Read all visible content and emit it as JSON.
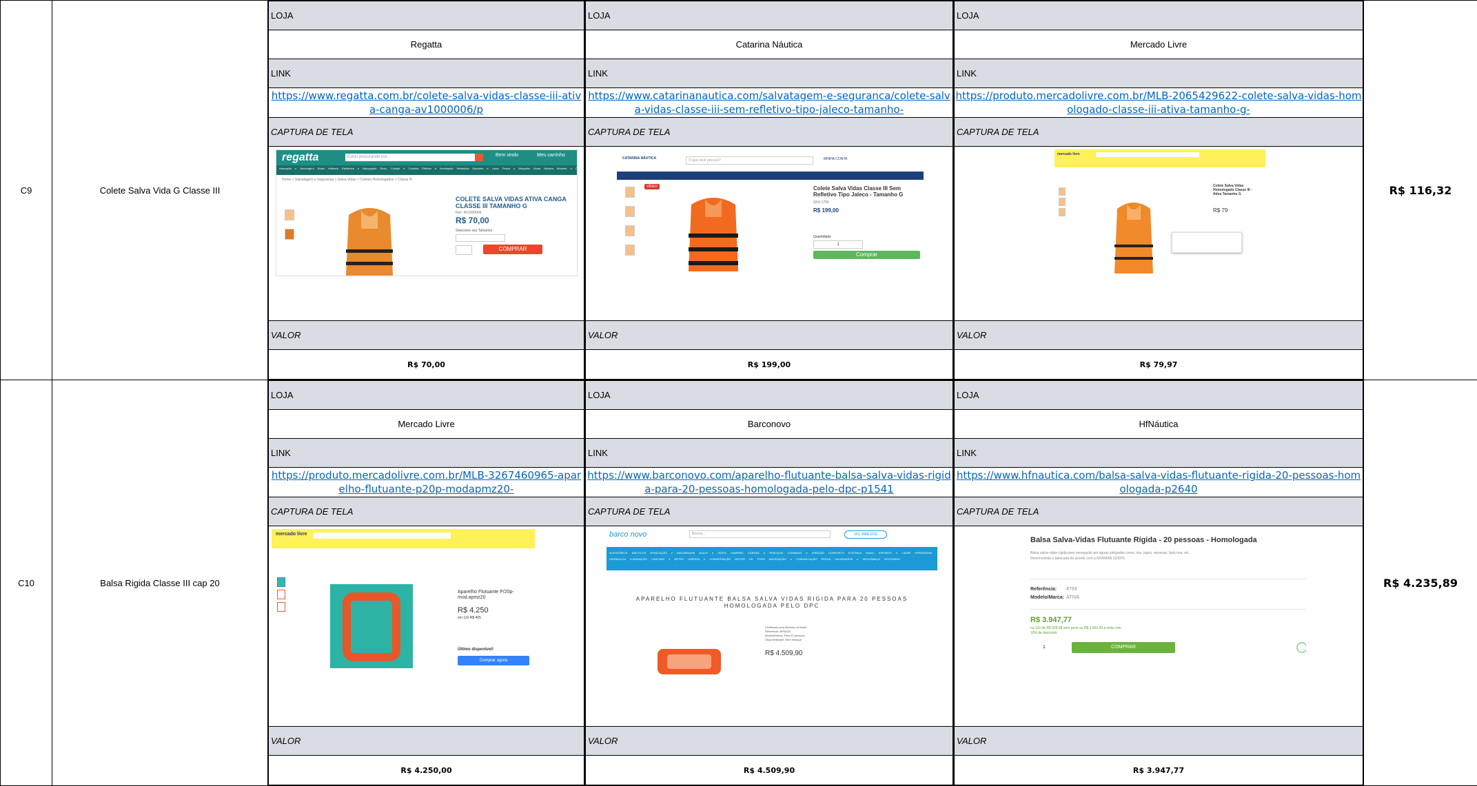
{
  "labels": {
    "loja": "LOJA",
    "link": "LINK",
    "captura": "CAPTURA DE TELA",
    "valor": "VALOR"
  },
  "rows": [
    {
      "code": "C9",
      "description": "Colete Salva Vida G Classe III",
      "average": "R$ 116,32",
      "stores": [
        {
          "name": "Regatta",
          "link": "https://www.regatta.com.br/colete-salva-vidas-classe-iii-ativa-canga-av1000006/p",
          "price": "R$ 70,00",
          "shot": {
            "logo": "regatta",
            "search": "Estou procurando por...",
            "login": "Bem vindo",
            "cart": "Meu carrinho",
            "nav": [
              "Atracação e Ancoragem",
              "Botes Infláveis",
              "Eletrônica e Navegação",
              "Deck, Cockpit e Cozinha",
              "Elétrica e Iluminação",
              "Hidráulica",
              "Esportes e Lazer",
              "Pesca e Mergulho",
              "Moda Náutica",
              "Motores e Óleos",
              "Vela e Barco",
              "Salvatagem e Segurança"
            ],
            "breadcrumb": "Home > Salvatagem e Segurança > Salva-Vidas > Coletes Homologados > Classe III",
            "title": "COLETE SALVA VIDAS ATIVA CANGA CLASSE III TAMANHO G",
            "ref": "Ref.: AV1000006",
            "price": "R$ 70,00",
            "size_label": "Selecione seu Tamanho",
            "sizes": [
              "P",
              "M",
              "G",
              "GG"
            ],
            "button": "COMPRAR",
            "accent": "#1f8f86"
          }
        },
        {
          "name": "Catarina Náutica",
          "link": "https://www.catarinanautica.com/salvatagem-e-seguranca/colete-salva-vidas-classe-iii-sem-refletivo-tipo-jaleco-tamanho-",
          "price": "R$ 199,00",
          "shot": {
            "logo": "CATARINA NÁUTICA",
            "search": "O que você procura?",
            "login": "MINHA CONTA",
            "title": "Colete Salva Vidas Classe III Sem Refletivo Tipo Jaleco - Tamanho G",
            "sku": "SKU:1755",
            "price": "R$ 199,00",
            "qty_label": "Quantidade",
            "qty": "1",
            "button": "Comprar",
            "badge": "VÍDEO",
            "accent": "#1d3f7a"
          }
        },
        {
          "name": "Mercado Livre",
          "link": "https://produto.mercadolivre.com.br/MLB-2065429622-colete-salva-vidas-homologado-classe-iii-ativa-tamanho-g-",
          "price": "R$ 79,97",
          "shot": {
            "logo": "mercado livre",
            "title": "Colete Salva Vidas Homologado Classe III - Ativa Tamanho G",
            "price": "R$ 79",
            "accent": "#fff159"
          }
        }
      ]
    },
    {
      "code": "C10",
      "description": "Balsa Rigida Classe III cap 20",
      "average": "R$ 4.235,89",
      "stores": [
        {
          "name": "Mercado Livre",
          "link": "https://produto.mercadolivre.com.br/MLB-3267460965-aparelho-flutuante-p20p-modapmz20-",
          "price": "R$ 4.250,00",
          "shot": {
            "logo": "mercado livre",
            "title": "Aparelho Flutuante P/20p-mod.apmz20",
            "price": "R$ 4.250",
            "installments": "em 12x R$ 405",
            "stock": "Último disponível!",
            "button": "Comprar agora",
            "accent": "#fff159"
          }
        },
        {
          "name": "Barconovo",
          "link": "https://www.barconovo.com/aparelho-flutuante-balsa-salva-vidas-rigida-para-20-pessoas-homologada-pelo-dpc-p1541",
          "price": "R$ 4.509,90",
          "shot": {
            "logo": "barco novo",
            "search": "Buscar...",
            "phone": "(41) 3088-2011",
            "nav": [
              "ACESSÓRIOS NÁUTICOS",
              "ATRACAÇÃO e ANCORAGEM",
              "ÁUDIO e VÍDEO",
              "CAMPING",
              "CORDAS e REBOQUE",
              "COMANDO e DIREÇÃO",
              "CONFORTO",
              "ELÉTRICA NAVAL",
              "ESPORTE e LAZER",
              "FERRAGENS",
              "HIDRÁULICA",
              "ILUMINAÇÃO",
              "LANCHAS e BOTES",
              "LIMPEZA e CONSERVAÇÃO",
              "MOTOR DE POPA",
              "NAVEGAÇÃO e COMUNICAÇÃO",
              "PESCA",
              "SALVATAGEM e SEGURANÇA",
              "VESTUÁRIO"
            ],
            "title": "APARELHO FLUTUANTE BALSA SALVA VIDAS RIGIDA PARA 20 PESSOAS HOMOLOGADA PELO DPC",
            "cert": "Certificado pela Marinha do Brasil",
            "ref": "Referência: APMZ20",
            "model": "Modelo/Marca: Para 20 pessoas",
            "avail": "Disponibilidade: Sem estoque",
            "price": "R$ 4.509,90",
            "accent": "#1b9ad6"
          }
        },
        {
          "name": "HfNáutica",
          "link": "https://www.hfnautica.com/balsa-salva-vidas-flutuante-rigida-20-pessoas-homologada-p2640",
          "price": "R$ 3.947,77",
          "shot": {
            "title": "Balsa Salva-Vidas Flutuante Rígida - 20 pessoas - Homologada",
            "desc1": "Balsa salva-vidas rígida para navegação em águas abrigadas como: rios, lagos, represas, baía mar, etc.",
            "desc2": "Desenvolvida e fabricada de acordo com a NORMAN 02/DPC.",
            "ref_label": "Referência:",
            "ref": "4793",
            "brand_label": "Modelo/Marca:",
            "brand": "ATIVA",
            "price": "R$ 3.947,77",
            "installments": "ou 12x de R$ 328,98 sem juros ou R$ 3.552,99 à vista com",
            "discount": "10% de desconto",
            "qty": "1",
            "button": "COMPRAR",
            "accent": "#6cb33e"
          }
        }
      ]
    }
  ]
}
